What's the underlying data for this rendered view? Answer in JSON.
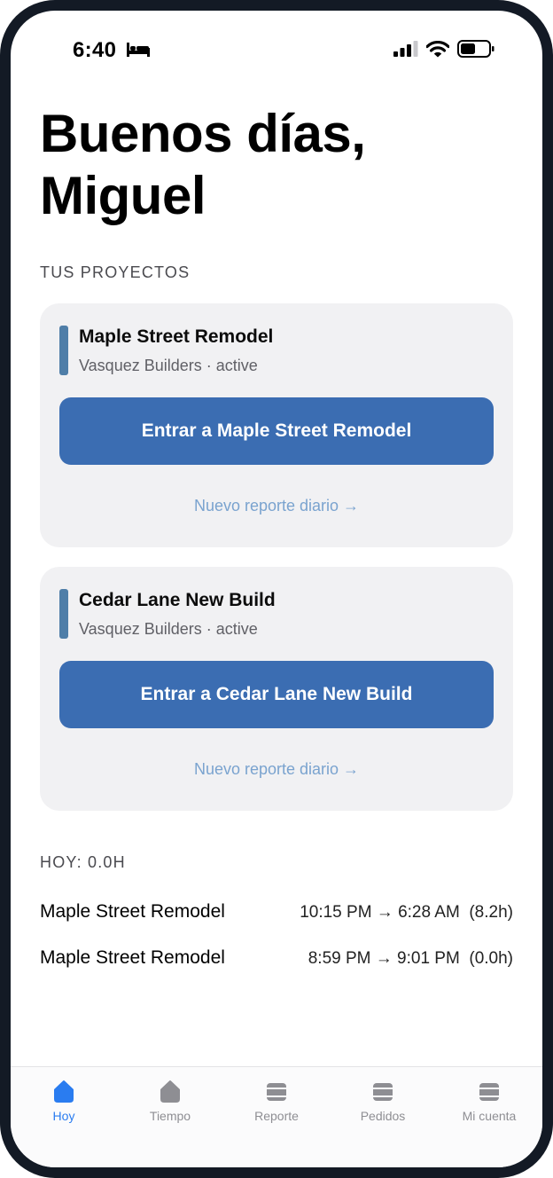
{
  "status_bar": {
    "time": "6:40"
  },
  "greeting": {
    "line1": "Buenos días,",
    "line2": "Miguel"
  },
  "projects_section": {
    "label": "TUS PROYECTOS"
  },
  "projects": [
    {
      "name": "Maple Street Remodel",
      "subtitle": "Vasquez Builders · active",
      "enter_label": "Entrar a Maple Street Remodel",
      "report_link": "Nuevo reporte diario →"
    },
    {
      "name": "Cedar Lane New Build",
      "subtitle": "Vasquez Builders · active",
      "enter_label": "Entrar a Cedar Lane New Build",
      "report_link": "Nuevo reporte diario →"
    }
  ],
  "today": {
    "label": "HOY: 0.0H",
    "entries": [
      {
        "project": "Maple Street Remodel",
        "range": "10:15 PM → 6:28 AM  (8.2h)"
      },
      {
        "project": "Maple Street Remodel",
        "range": "8:59 PM → 9:01 PM  (0.0h)"
      }
    ]
  },
  "tabs": [
    {
      "label": "Hoy",
      "icon": "home-icon",
      "active": true
    },
    {
      "label": "Tiempo",
      "icon": "home-icon"
    },
    {
      "label": "Reporte",
      "icon": "tray-icon"
    },
    {
      "label": "Pedidos",
      "icon": "tray-icon"
    },
    {
      "label": "Mi cuenta",
      "icon": "tray-icon"
    }
  ],
  "colors": {
    "accent_button": "#3b6db2",
    "project_bar": "#4f7ea8",
    "link": "#7aa3cf",
    "tab_active": "#2a7cf0",
    "card_bg": "#f1f1f3"
  }
}
